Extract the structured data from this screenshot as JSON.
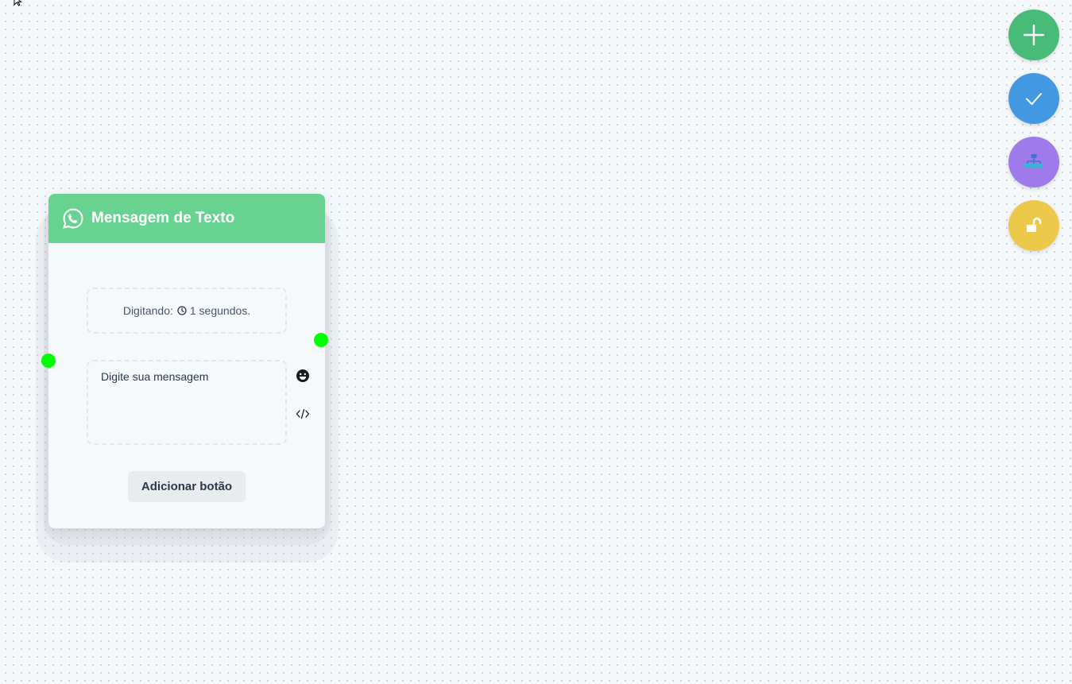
{
  "node": {
    "title": "Mensagem de Texto",
    "header_icon": "whatsapp-icon",
    "header_color": "#68d391",
    "typing": {
      "label": "Digitando:",
      "icon": "clock-icon",
      "value": "1 segundos."
    },
    "message": {
      "value": "Digite sua mensagem"
    },
    "side_icons": [
      "emoji-icon",
      "code-icon"
    ],
    "add_button_label": "Adicionar botão",
    "handle_color": "#00ff00"
  },
  "fabs": [
    {
      "name": "add",
      "icon": "plus-icon",
      "color": "#48bb78"
    },
    {
      "name": "confirm",
      "icon": "check-icon",
      "color": "#4299e1"
    },
    {
      "name": "organize",
      "icon": "sitemap-icon",
      "color": "#9f7aea"
    },
    {
      "name": "lock",
      "icon": "unlock-icon",
      "color": "#ecc94b"
    }
  ]
}
